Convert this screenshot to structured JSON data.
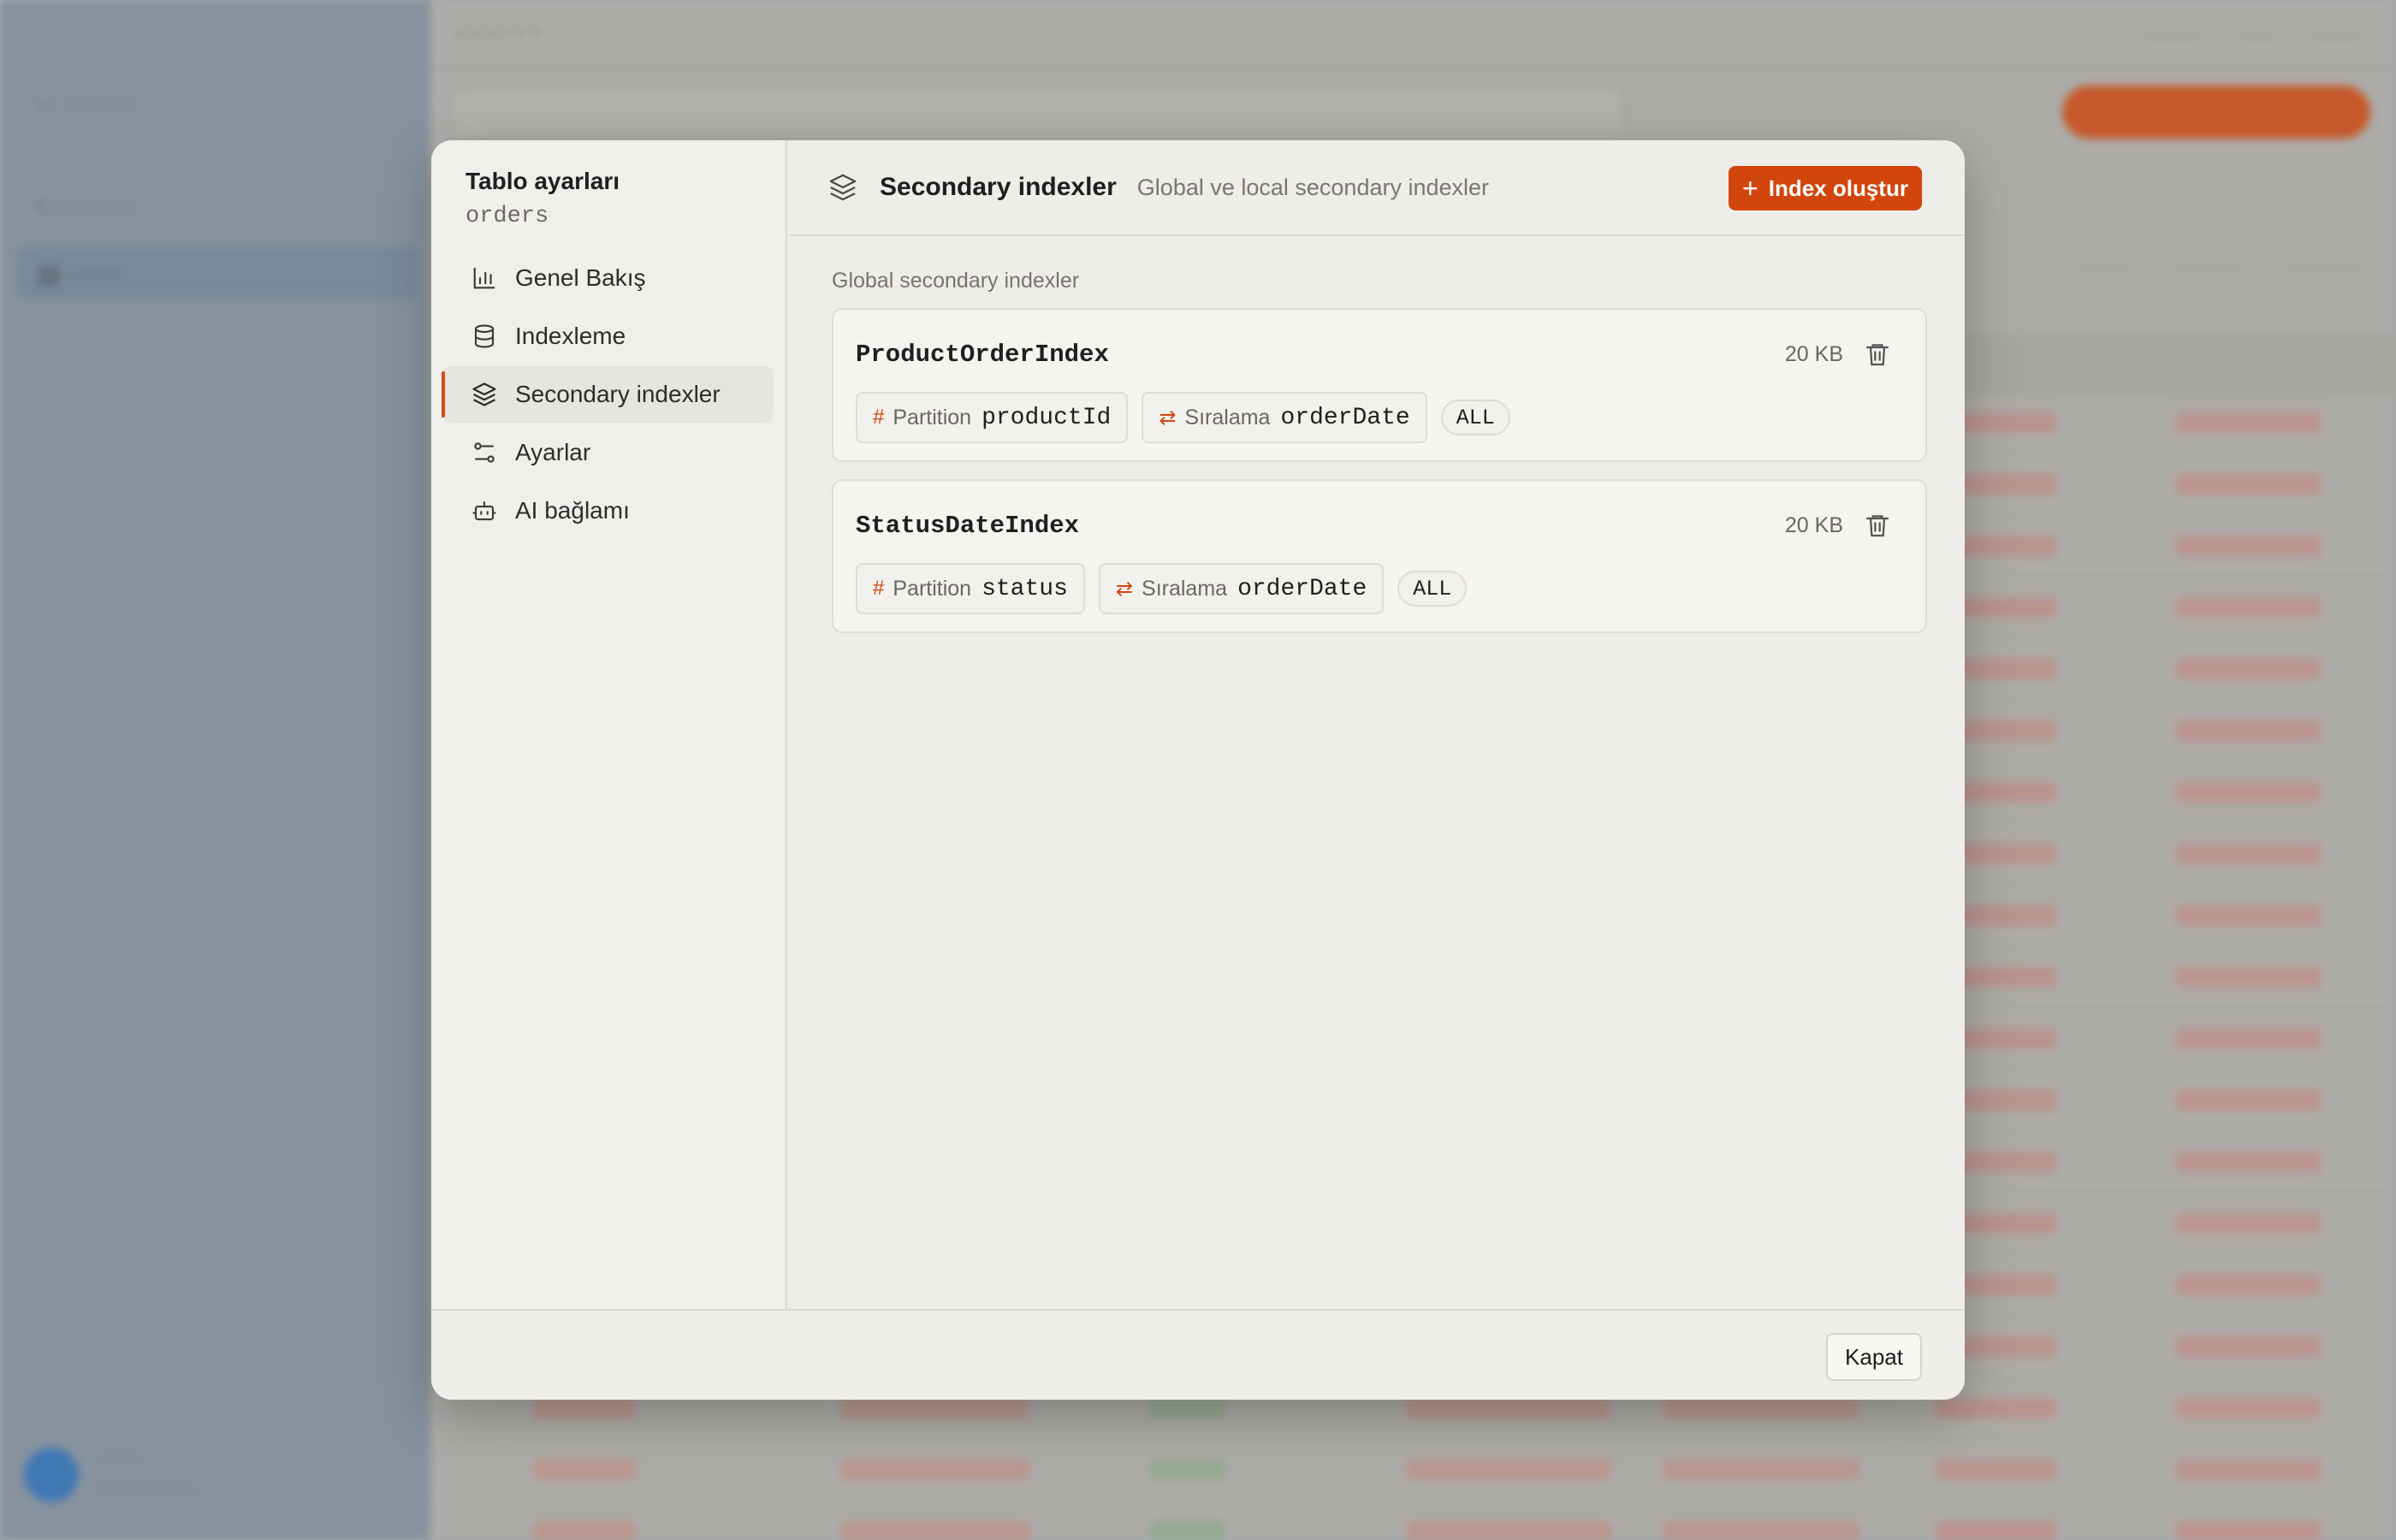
{
  "modal": {
    "side_title": "Tablo ayarları",
    "table_name": "orders",
    "nav": [
      {
        "label": "Genel Bakış",
        "icon": "bar-chart-icon"
      },
      {
        "label": "Indexleme",
        "icon": "database-icon"
      },
      {
        "label": "Secondary indexler",
        "icon": "layers-icon",
        "active": true
      },
      {
        "label": "Ayarlar",
        "icon": "sliders-icon"
      },
      {
        "label": "AI bağlamı",
        "icon": "bot-icon"
      }
    ],
    "header": {
      "title": "Secondary indexler",
      "description": "Global ve local secondary indexler",
      "create_button": "Index oluştur"
    },
    "section_label": "Global secondary indexler",
    "indexes": [
      {
        "name": "ProductOrderIndex",
        "size": "20 KB",
        "partition_label": "Partition",
        "partition_key": "productId",
        "sort_label": "Sıralama",
        "sort_key": "orderDate",
        "projection": "ALL"
      },
      {
        "name": "StatusDateIndex",
        "size": "20 KB",
        "partition_label": "Partition",
        "partition_key": "status",
        "sort_label": "Sıralama",
        "sort_key": "orderDate",
        "projection": "ALL"
      }
    ],
    "close_button": "Kapat"
  },
  "colors": {
    "accent": "#d2460e",
    "modal_bg": "#efede9",
    "backdrop": "#a9a8a4"
  }
}
